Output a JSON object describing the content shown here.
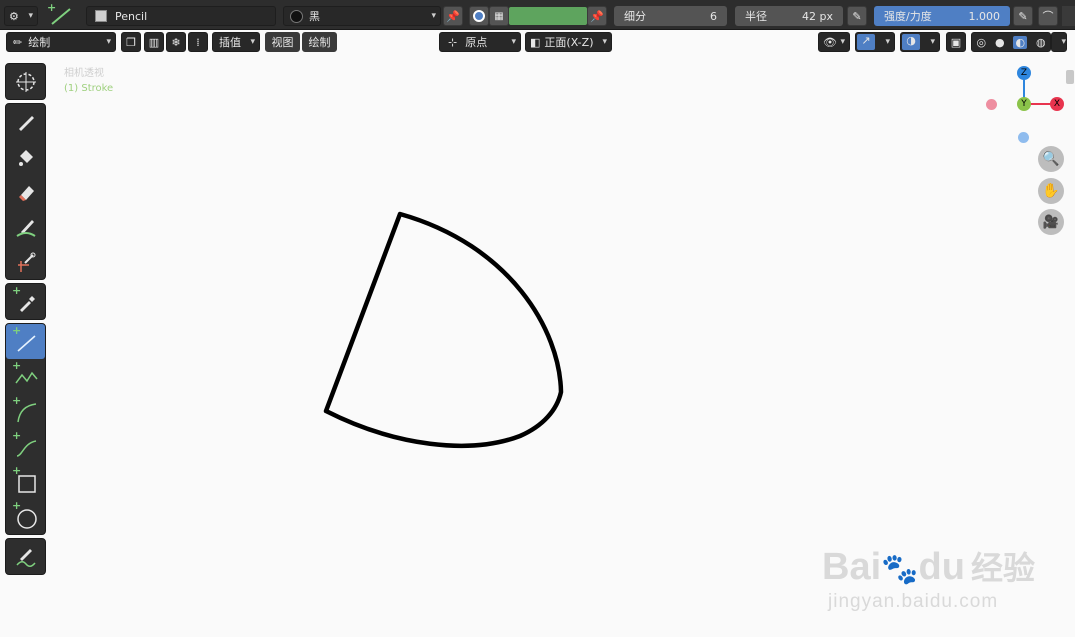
{
  "header": {
    "brush_name": "Pencil",
    "material_name": "黑",
    "subdivide_label": "细分",
    "subdivide_value": "6",
    "radius_label": "半径",
    "radius_value": "42 px",
    "strength_label": "强度/力度",
    "strength_value": "1.000",
    "color_swatch": "#5ea45e",
    "strength_color": "#4f7fc4"
  },
  "toolrow": {
    "mode_label": "绘制",
    "interpolate_label": "插值",
    "view_menu": "视图",
    "draw_menu": "绘制",
    "origin_label": "原点",
    "plane_label": "正面(X-Z)"
  },
  "viewport": {
    "view_name": "相机透视",
    "object_name": "(1) Stroke"
  },
  "gizmo": {
    "z_label": "Z",
    "y_label": "Y",
    "x_label": "X",
    "z_color": "#2e86de",
    "y_color": "#8bc34a",
    "x_color": "#e8344e"
  },
  "watermark": {
    "brand": "Bai",
    "brand_du": "du",
    "brand_cn": "经验",
    "url": "jingyan.baidu.com"
  }
}
